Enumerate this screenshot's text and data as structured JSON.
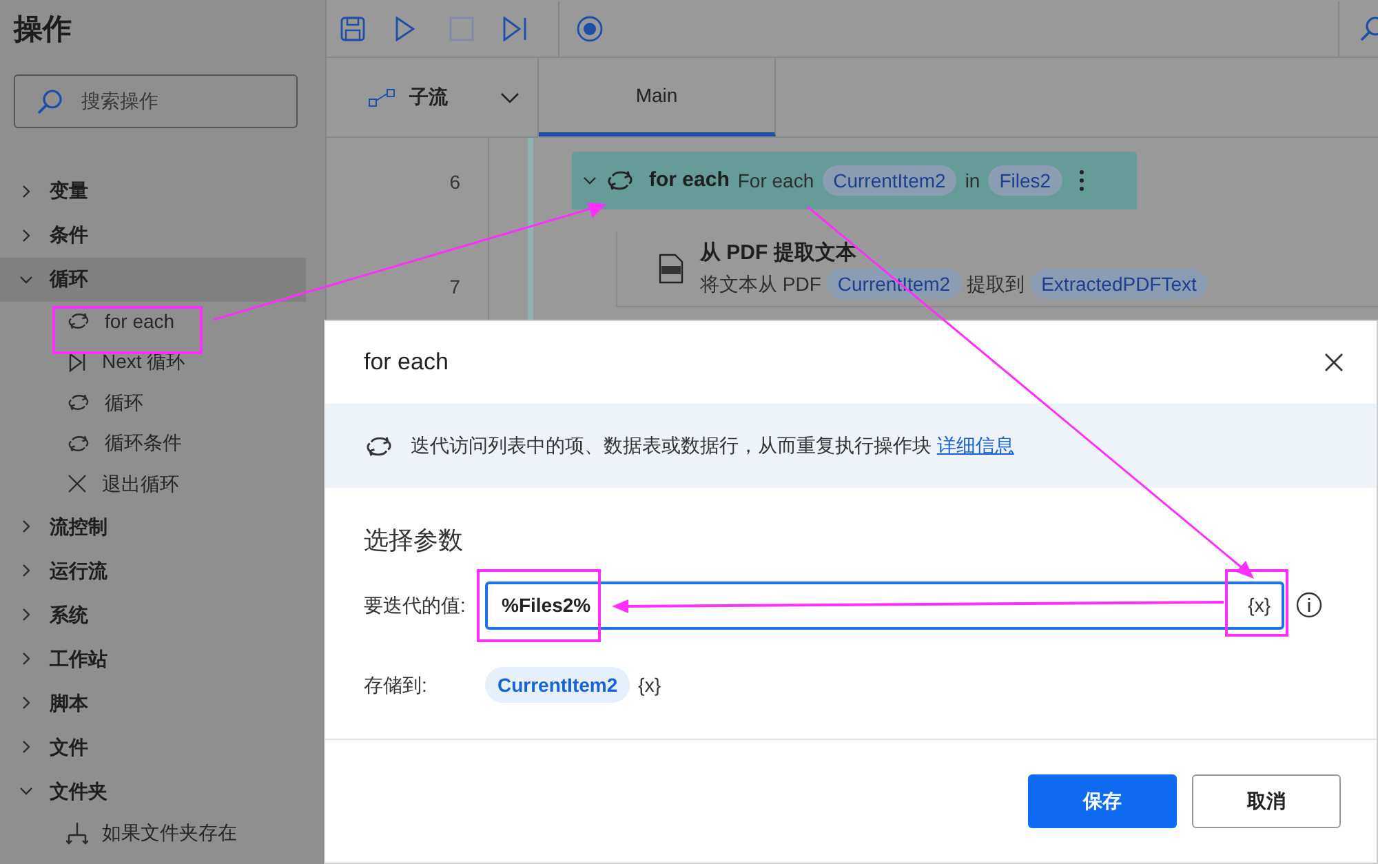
{
  "sidebar": {
    "title": "操作",
    "search": {
      "placeholder": "搜索操作"
    },
    "categories": [
      {
        "label": "变量",
        "expanded": false,
        "selected": false
      },
      {
        "label": "条件",
        "expanded": false,
        "selected": false
      },
      {
        "label": "循环",
        "expanded": true,
        "selected": true,
        "children": [
          {
            "label": "for each",
            "kind": "loop"
          },
          {
            "label": "Next 循环",
            "kind": "next"
          },
          {
            "label": "循环",
            "kind": "loop"
          },
          {
            "label": "循环条件",
            "kind": "loop"
          },
          {
            "label": "退出循环",
            "kind": "exit"
          }
        ]
      },
      {
        "label": "流控制",
        "expanded": false,
        "selected": false
      },
      {
        "label": "运行流",
        "expanded": false,
        "selected": false
      },
      {
        "label": "系统",
        "expanded": false,
        "selected": false
      },
      {
        "label": "工作站",
        "expanded": false,
        "selected": false
      },
      {
        "label": "脚本",
        "expanded": false,
        "selected": false
      },
      {
        "label": "文件",
        "expanded": false,
        "selected": false
      },
      {
        "label": "文件夹",
        "expanded": true,
        "selected": false,
        "children": [
          {
            "label": "如果文件夹存在",
            "kind": "branch"
          }
        ]
      }
    ]
  },
  "tabs": [
    {
      "label": "子流",
      "kind": "subflows",
      "selected": false
    },
    {
      "label": "Main",
      "kind": "tab",
      "selected": true
    }
  ],
  "flow": [
    {
      "number": "6",
      "kind": "loop",
      "title": "for each",
      "parts": [
        {
          "text": "For each",
          "kind": "text"
        },
        {
          "text": "CurrentItem2",
          "kind": "var"
        },
        {
          "text": "in",
          "kind": "text"
        },
        {
          "text": "Files2",
          "kind": "var"
        }
      ]
    },
    {
      "number": "7",
      "kind": "action",
      "title": "从 PDF 提取文本",
      "parts": [
        {
          "text": "将文本从 PDF",
          "kind": "text"
        },
        {
          "text": "CurrentItem2",
          "kind": "var"
        },
        {
          "text": "提取到",
          "kind": "text"
        },
        {
          "text": "ExtractedPDFText",
          "kind": "var"
        }
      ]
    }
  ],
  "dialog": {
    "title": "for each",
    "description": "迭代访问列表中的项、数据表或数据行，从而重复执行操作块",
    "link": "详细信息",
    "section": "选择参数",
    "fields": [
      {
        "label": "要迭代的值:",
        "kind": "input",
        "value": "%Files2%",
        "var_button": "{x}"
      },
      {
        "label": "存储到:",
        "kind": "var",
        "value": "CurrentItem2",
        "var_button": "{x}"
      }
    ],
    "buttons": [
      {
        "label": "保存",
        "kind": "primary"
      },
      {
        "label": "取消",
        "kind": "secondary"
      }
    ]
  }
}
